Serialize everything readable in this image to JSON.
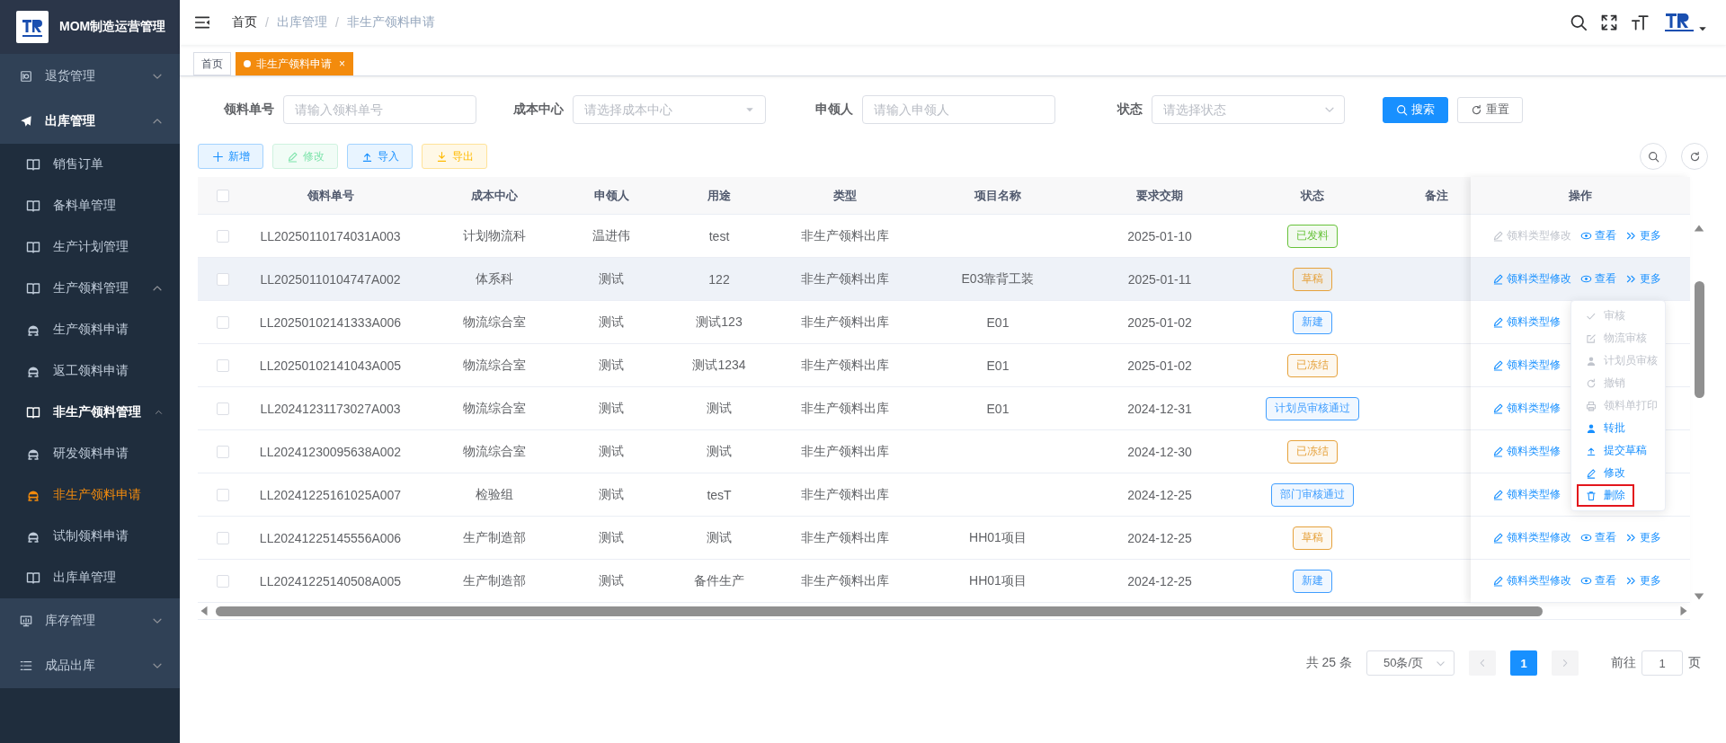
{
  "sidebar": {
    "title": "MOM制造运营管理",
    "menu": [
      {
        "label": "退货管理",
        "selected": false,
        "expanded": false
      },
      {
        "label": "出库管理",
        "selected": false,
        "expanded": true,
        "children": [
          {
            "label": "销售订单",
            "selected": false
          },
          {
            "label": "备料单管理",
            "selected": false
          },
          {
            "label": "生产计划管理",
            "selected": false
          },
          {
            "label": "生产领料管理",
            "selected": false,
            "expanded": true,
            "children": [
              {
                "label": "生产领料申请",
                "selected": false
              },
              {
                "label": "返工领料申请",
                "selected": false
              }
            ]
          },
          {
            "label": "非生产领料管理",
            "selected": false,
            "expanded": true,
            "children": [
              {
                "label": "研发领料申请",
                "selected": false
              },
              {
                "label": "非生产领料申请",
                "selected": true
              },
              {
                "label": "试制领料申请",
                "selected": false
              }
            ]
          },
          {
            "label": "出库单管理",
            "selected": false
          }
        ]
      },
      {
        "label": "库存管理",
        "selected": false,
        "expanded": false
      },
      {
        "label": "成品出库",
        "selected": false,
        "expanded": false
      }
    ]
  },
  "header": {
    "breadcrumb": [
      {
        "label": "首页"
      },
      {
        "label": "出库管理",
        "separator": "/"
      },
      {
        "label": "非生产领料申请",
        "separator": "/"
      }
    ]
  },
  "tabs": [
    {
      "label": "首页",
      "selected": false
    },
    {
      "label": "非生产领料申请",
      "selected": true,
      "close": "×"
    }
  ],
  "filters": [
    {
      "label": "领料单号",
      "kind": "input",
      "placeholder": "请输入领料单号"
    },
    {
      "label": "成本中心",
      "kind": "select",
      "placeholder": "请选择成本中心"
    },
    {
      "label": "申领人",
      "kind": "input",
      "placeholder": "请输入申领人"
    },
    {
      "label": "状态",
      "kind": "select",
      "placeholder": "请选择状态"
    }
  ],
  "filter_buttons": [
    {
      "label": "搜索",
      "kind": "search"
    },
    {
      "label": "重置",
      "kind": "reset"
    }
  ],
  "toolbar": [
    {
      "label": "新增",
      "kind": "add",
      "disabled": false
    },
    {
      "label": "修改",
      "kind": "edit",
      "disabled": true
    },
    {
      "label": "导入",
      "kind": "import",
      "disabled": false
    },
    {
      "label": "导出",
      "kind": "export",
      "disabled": false
    }
  ],
  "table": {
    "all_checked": false,
    "columns": [
      "领料单号",
      "成本中心",
      "申领人",
      "用途",
      "类型",
      "项目名称",
      "要求交期",
      "状态",
      "备注"
    ],
    "action_column": "操作",
    "rows": [
      {
        "checked": false,
        "hovered": false,
        "no": "LL20250110174031A003",
        "center": "计划物流科",
        "applicant": "温进伟",
        "purpose": "test",
        "type": "非生产领料出库",
        "due": "2025-01-10",
        "status": {
          "label": "已发料",
          "color": "#67c23a"
        },
        "actions": [
          {
            "kind": "edit",
            "label": "领料类型修改",
            "disabled": true
          },
          {
            "kind": "view",
            "label": "查看",
            "disabled": false
          },
          {
            "kind": "more",
            "label": "更多",
            "disabled": false
          }
        ]
      },
      {
        "checked": false,
        "hovered": true,
        "no": "LL20250110104747A002",
        "center": "体系科",
        "applicant": "测试",
        "purpose": "122",
        "type": "非生产领料出库",
        "project": "E03靠背工装",
        "due": "2025-01-11",
        "status": {
          "label": "草稿",
          "color": "#e6a23c"
        },
        "actions": [
          {
            "kind": "edit",
            "label": "领料类型修改",
            "disabled": false
          },
          {
            "kind": "view",
            "label": "查看",
            "disabled": false
          },
          {
            "kind": "more",
            "label": "更多",
            "disabled": false
          }
        ]
      },
      {
        "checked": false,
        "hovered": false,
        "no": "LL20250102141333A006",
        "center": "物流综合室",
        "applicant": "测试",
        "purpose": "测试123",
        "type": "非生产领料出库",
        "project": "E01",
        "due": "2025-01-02",
        "status": {
          "label": "新建",
          "color": "#409eff"
        },
        "actions": [
          {
            "kind": "edit",
            "label": "领料类型修",
            "disabled": false
          }
        ]
      },
      {
        "checked": false,
        "hovered": false,
        "no": "LL20250102141043A005",
        "center": "物流综合室",
        "applicant": "测试",
        "purpose": "测试1234",
        "type": "非生产领料出库",
        "project": "E01",
        "due": "2025-01-02",
        "status": {
          "label": "已冻结",
          "color": "#e6a23c"
        },
        "actions": [
          {
            "kind": "edit",
            "label": "领料类型修",
            "disabled": false
          }
        ]
      },
      {
        "checked": false,
        "hovered": false,
        "no": "LL20241231173027A003",
        "center": "物流综合室",
        "applicant": "测试",
        "purpose": "测试",
        "type": "非生产领料出库",
        "project": "E01",
        "due": "2024-12-31",
        "status": {
          "label": "计划员审核通过",
          "color": "#409eff"
        },
        "actions": [
          {
            "kind": "edit",
            "label": "领料类型修",
            "disabled": false
          }
        ]
      },
      {
        "checked": false,
        "hovered": false,
        "no": "LL20241230095638A002",
        "center": "物流综合室",
        "applicant": "测试",
        "purpose": "测试",
        "type": "非生产领料出库",
        "due": "2024-12-30",
        "status": {
          "label": "已冻结",
          "color": "#e6a23c"
        },
        "actions": [
          {
            "kind": "edit",
            "label": "领料类型修",
            "disabled": false
          }
        ]
      },
      {
        "checked": false,
        "hovered": false,
        "no": "LL20241225161025A007",
        "center": "检验组",
        "applicant": "测试",
        "purpose": "tesT",
        "type": "非生产领料出库",
        "due": "2024-12-25",
        "status": {
          "label": "部门审核通过",
          "color": "#409eff"
        },
        "actions": [
          {
            "kind": "edit",
            "label": "领料类型修",
            "disabled": false
          }
        ]
      },
      {
        "checked": false,
        "hovered": false,
        "no": "LL20241225145556A006",
        "center": "生产制造部",
        "applicant": "测试",
        "purpose": "测试",
        "type": "非生产领料出库",
        "project": "HH01项目",
        "due": "2024-12-25",
        "status": {
          "label": "草稿",
          "color": "#e6a23c"
        },
        "actions": [
          {
            "kind": "edit",
            "label": "领料类型修改",
            "disabled": false
          },
          {
            "kind": "view",
            "label": "查看",
            "disabled": false
          },
          {
            "kind": "more",
            "label": "更多",
            "disabled": false
          }
        ]
      },
      {
        "checked": false,
        "hovered": false,
        "no": "LL20241225140508A005",
        "center": "生产制造部",
        "applicant": "测试",
        "purpose": "备件生产",
        "type": "非生产领料出库",
        "project": "HH01项目",
        "due": "2024-12-25",
        "status": {
          "label": "新建",
          "color": "#409eff"
        },
        "actions": [
          {
            "kind": "edit",
            "label": "领料类型修改",
            "disabled": false
          },
          {
            "kind": "view",
            "label": "查看",
            "disabled": false
          },
          {
            "kind": "more",
            "label": "更多",
            "disabled": false
          }
        ]
      }
    ]
  },
  "more_menu": [
    {
      "label": "审核",
      "kind": "check",
      "disabled": true,
      "highlighted": false
    },
    {
      "label": "物流审核",
      "kind": "note",
      "disabled": true,
      "highlighted": false
    },
    {
      "label": "计划员审核",
      "kind": "user",
      "disabled": true,
      "highlighted": false
    },
    {
      "label": "撤销",
      "kind": "undo",
      "disabled": true,
      "highlighted": false
    },
    {
      "label": "领料单打印",
      "kind": "print",
      "disabled": true,
      "highlighted": false
    },
    {
      "label": "转批",
      "kind": "user",
      "disabled": false,
      "highlighted": false
    },
    {
      "label": "提交草稿",
      "kind": "upload",
      "disabled": false,
      "highlighted": false
    },
    {
      "label": "修改",
      "kind": "pencil",
      "disabled": false,
      "highlighted": false
    },
    {
      "label": "删除",
      "kind": "trash",
      "disabled": false,
      "highlighted": true
    }
  ],
  "pagination": {
    "total": "共 25 条",
    "page_size": "50条/页",
    "prev_disabled": true,
    "next_disabled": true,
    "pages": [
      {
        "label": "1",
        "selected": true
      }
    ],
    "goto_label": "前往",
    "goto_value": "1",
    "goto_suffix": "页"
  }
}
